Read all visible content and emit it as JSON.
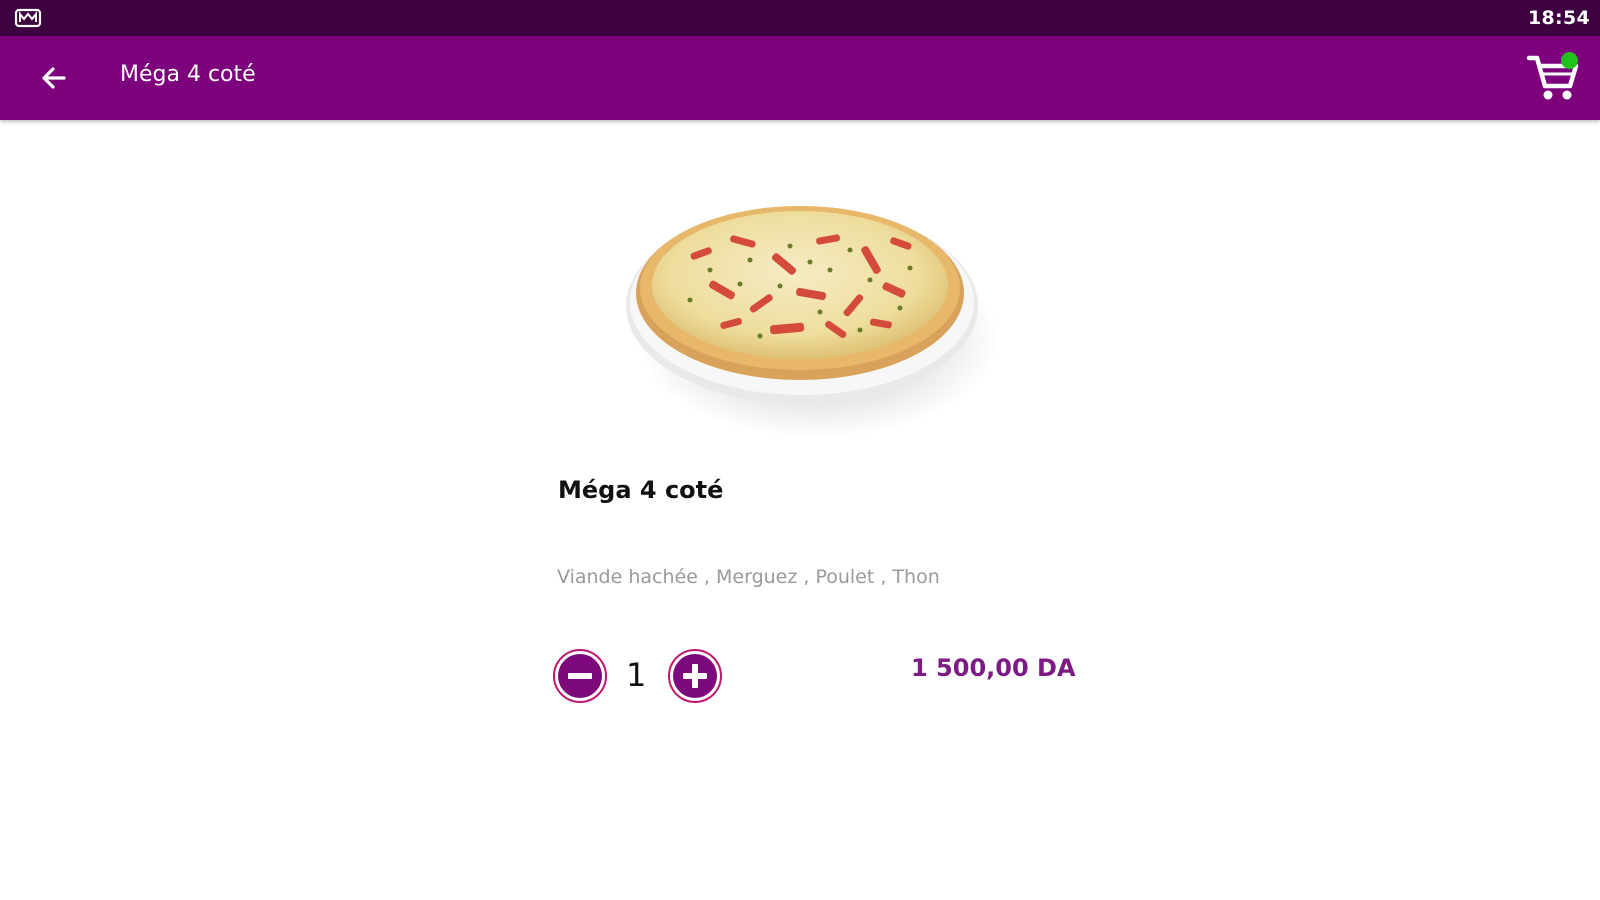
{
  "status_bar": {
    "left_icon": "notification-icon",
    "time": "18:54"
  },
  "app_bar": {
    "back_icon": "arrow-left-icon",
    "title": "Méga 4 coté",
    "cart_icon": "shopping-cart-icon",
    "cart_badge_color": "#21c21d",
    "background_color": "#7d007d"
  },
  "product": {
    "image": "pizza-image",
    "name": "Méga 4 coté",
    "ingredients": "Viande hachée , Merguez , Poulet , Thon",
    "quantity": "1",
    "price": "1 500,00 DA",
    "price_color": "#7d1a86"
  },
  "controls": {
    "decrease_icon": "minus-circle-icon",
    "increase_icon": "plus-circle-icon"
  }
}
